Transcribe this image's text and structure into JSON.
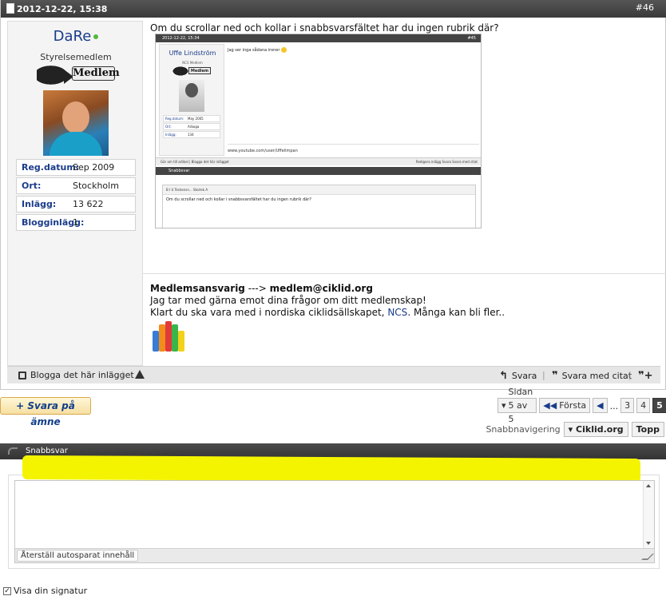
{
  "post": {
    "date": "2012-12-22, 15:38",
    "number": "#46",
    "title": "Om du scrollar ned och kollar i snabbsvarsfältet har du ingen rubrik där?",
    "user": {
      "name": "DaRe",
      "title": "Styrelsemedlem",
      "rank_label": "Medlem",
      "info": [
        {
          "key": "Reg.datum:",
          "value": "Sep 2009"
        },
        {
          "key": "Ort:",
          "value": "Stockholm"
        },
        {
          "key": "Inlägg:",
          "value": "13 622"
        },
        {
          "key": "Blogginlägg:",
          "value": "1"
        }
      ]
    },
    "embedded_screenshot": {
      "date": "2012-12-22, 15:34",
      "number": "#45",
      "user_name": "Uffe Lindström",
      "user_title": "NCS Medlem",
      "rank_label": "Medlem",
      "info": [
        {
          "key": "Reg.datum:",
          "value": "May 2005"
        },
        {
          "key": "Ort:",
          "value": "Arboga"
        },
        {
          "key": "Inlägg:",
          "value": "134"
        }
      ],
      "text": "Jag ser inga sådana ironer",
      "link": "www.youtube.com/user/Uffelimpan",
      "toolbar_left": "Gör om till artikel  |  Blogga det här inlägget",
      "toolbar_right": "Redigera inlägg   Svara   Svara med citat",
      "quick_reply": "Snabbsvar",
      "editor_toolbar": "B  I  U  Teckensn...  Storlek  A",
      "editor_text": "Om du scrollar ned och kollar i snabbsvarsfältet har du ingen rubrik där?"
    },
    "signature": {
      "label": "Medlemsansvarig",
      "arrow": "--->",
      "email": "medlem@ciklid.org",
      "line1": "Jag tar med gärna emot dina frågor om ditt medlemskap!",
      "line2_prefix": "Klart du ska vara med i nordiska ciklidsällskapet,",
      "line2_link": "NCS",
      "line2_suffix": ". Många kan bli fler.."
    },
    "footer": {
      "blog": "Blogga det här inlägget",
      "reply": "Svara",
      "reply_quote": "Svara med citat"
    }
  },
  "reply_button": "+ Svara på ämne",
  "pagination": {
    "page_info": "Sidan 5 av 5",
    "first": "Första",
    "ellipsis": "...",
    "pages": [
      "3",
      "4",
      "5"
    ],
    "current": "5"
  },
  "quick_nav": {
    "label": "Snabbnavigering",
    "forum": "Ciklid.org",
    "top": "Topp"
  },
  "quick_reply": {
    "title": "Snabbsvar",
    "restore": "Återställ autosparat innehåll",
    "signature": "Visa din signatur"
  },
  "colors": {
    "header_bg": "#3a3a3a",
    "link": "#1a3c8a",
    "highlight": "#f4f400",
    "reply_button": "#f6dfa1"
  }
}
